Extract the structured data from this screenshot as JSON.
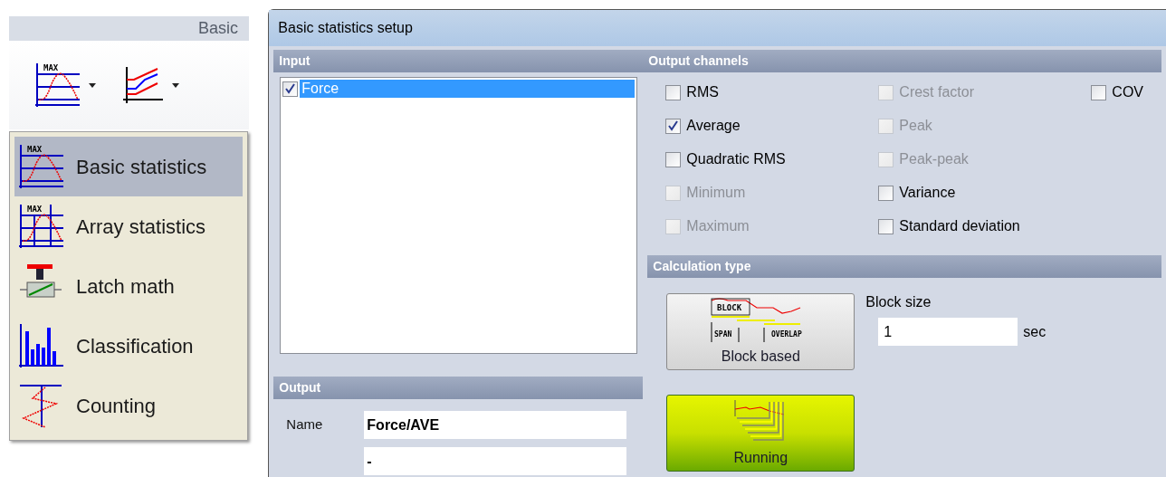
{
  "ribbon": {
    "group_title": "Basic",
    "buttons": [
      {
        "kind": "max-chart",
        "icon_text": "MAX"
      },
      {
        "kind": "trend-chart"
      }
    ]
  },
  "menu": {
    "items": [
      {
        "label": "Basic statistics",
        "selected": true,
        "icon_text": "MAX"
      },
      {
        "label": "Array statistics",
        "selected": false,
        "icon_text": "MAX"
      },
      {
        "label": "Latch math",
        "selected": false
      },
      {
        "label": "Classification",
        "selected": false
      },
      {
        "label": "Counting",
        "selected": false
      }
    ]
  },
  "dialog": {
    "title": "Basic statistics setup",
    "input": {
      "header": "Input",
      "items": [
        {
          "label": "Force",
          "checked": true,
          "selected": true
        }
      ]
    },
    "output": {
      "header": "Output",
      "name_label": "Name",
      "name_value": "Force/AVE",
      "second_value": "-"
    },
    "output_channels": {
      "header": "Output channels",
      "columns": [
        [
          {
            "label": "RMS",
            "checked": false,
            "disabled": false
          },
          {
            "label": "Average",
            "checked": true,
            "disabled": false
          },
          {
            "label": "Quadratic RMS",
            "checked": false,
            "disabled": false
          },
          {
            "label": "Minimum",
            "checked": false,
            "disabled": true
          },
          {
            "label": "Maximum",
            "checked": false,
            "disabled": true
          }
        ],
        [
          {
            "label": "Crest factor",
            "checked": false,
            "disabled": true
          },
          {
            "label": "Peak",
            "checked": false,
            "disabled": true
          },
          {
            "label": "Peak-peak",
            "checked": false,
            "disabled": true
          },
          {
            "label": "Variance",
            "checked": false,
            "disabled": false
          },
          {
            "label": "Standard deviation",
            "checked": false,
            "disabled": false
          }
        ],
        [
          {
            "label": "COV",
            "checked": false,
            "disabled": false
          }
        ]
      ]
    },
    "calculation": {
      "header": "Calculation type",
      "types": [
        {
          "label": "Block based",
          "selected": false,
          "icon_texts": [
            "BLOCK",
            "SPAN",
            "OVERLAP"
          ]
        },
        {
          "label": "Running",
          "selected": true
        }
      ],
      "block_size_label": "Block size",
      "block_size_value": "1",
      "unit": "sec"
    }
  }
}
